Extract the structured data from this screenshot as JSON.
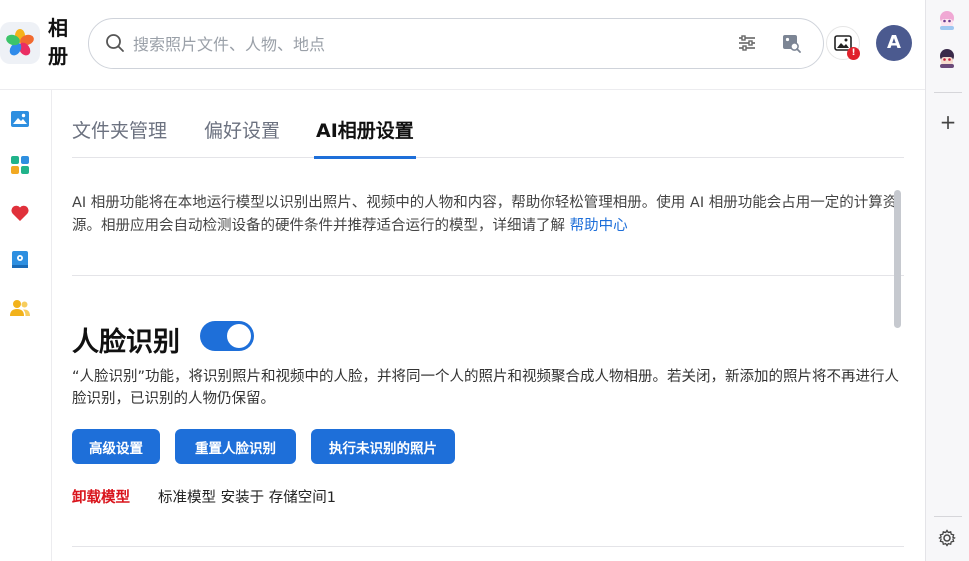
{
  "app": {
    "title": "相册"
  },
  "search": {
    "placeholder": "搜索照片文件、人物、地点"
  },
  "header": {
    "notification_badge": "!",
    "avatar_letter": "A"
  },
  "tabs": [
    {
      "label": "文件夹管理",
      "active": false
    },
    {
      "label": "偏好设置",
      "active": false
    },
    {
      "label": "AI相册设置",
      "active": true
    }
  ],
  "intro": {
    "text": "AI 相册功能将在本地运行模型以识别出照片、视频中的人物和内容，帮助你轻松管理相册。使用 AI 相册功能会占用一定的计算资源。相册应用会自动检测设备的硬件条件并推荐适合运行的模型，详细请了解 ",
    "link": "帮助中心"
  },
  "face_recognition": {
    "title": "人脸识别",
    "enabled": true,
    "description": "“人脸识别”功能，将识别照片和视频中的人脸，并将同一个人的照片和视频聚合成人物相册。若关闭，新添加的照片将不再进行人脸识别，已识别的人物仍保留。",
    "buttons": {
      "advanced": "高级设置",
      "reset": "重置人脸识别",
      "run_unrecognized": "执行未识别的照片"
    },
    "uninstall_label": "卸载模型",
    "model_info": "标准模型 安装于 存储空间1"
  },
  "left_nav_icons": [
    "photos-icon",
    "albums-icon",
    "favorites-icon",
    "shared-album-icon",
    "people-icon"
  ],
  "right_rail_icons": [
    "anime-avatar-pink-icon",
    "anime-avatar-dark-icon",
    "add-icon",
    "settings-icon"
  ],
  "colors": {
    "accent": "#1e6fd9",
    "danger": "#d9141c",
    "avatar_bg": "#4b5a8f"
  }
}
